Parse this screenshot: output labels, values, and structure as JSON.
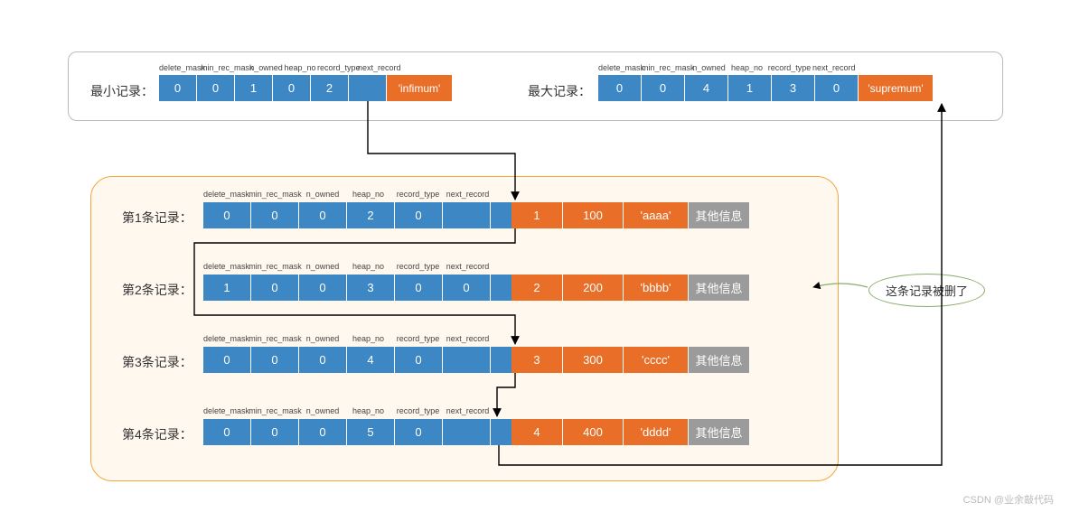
{
  "header_fields": [
    "delete_mask",
    "min_rec_mask",
    "n_owned",
    "heap_no",
    "record_type",
    "next_record"
  ],
  "top": {
    "min": {
      "label": "最小记录：",
      "cells": [
        "0",
        "0",
        "1",
        "0",
        "2",
        ""
      ],
      "payload": "'infimum'"
    },
    "max": {
      "label": "最大记录：",
      "cells": [
        "0",
        "0",
        "4",
        "1",
        "3",
        "0"
      ],
      "payload": "'supremum'"
    }
  },
  "rows": [
    {
      "label": "第1条记录：",
      "cells": [
        "0",
        "0",
        "0",
        "2",
        "0",
        ""
      ],
      "data": [
        "1",
        "100",
        "'aaaa'"
      ],
      "extra": "其他信息"
    },
    {
      "label": "第2条记录：",
      "cells": [
        "1",
        "0",
        "0",
        "3",
        "0",
        "0"
      ],
      "data": [
        "2",
        "200",
        "'bbbb'"
      ],
      "extra": "其他信息"
    },
    {
      "label": "第3条记录：",
      "cells": [
        "0",
        "0",
        "0",
        "4",
        "0",
        ""
      ],
      "data": [
        "3",
        "300",
        "'cccc'"
      ],
      "extra": "其他信息"
    },
    {
      "label": "第4条记录：",
      "cells": [
        "0",
        "0",
        "0",
        "5",
        "0",
        ""
      ],
      "data": [
        "4",
        "400",
        "'dddd'"
      ],
      "extra": "其他信息"
    }
  ],
  "annotation": "这条记录被删了",
  "watermark": "CSDN @业余敲代码"
}
